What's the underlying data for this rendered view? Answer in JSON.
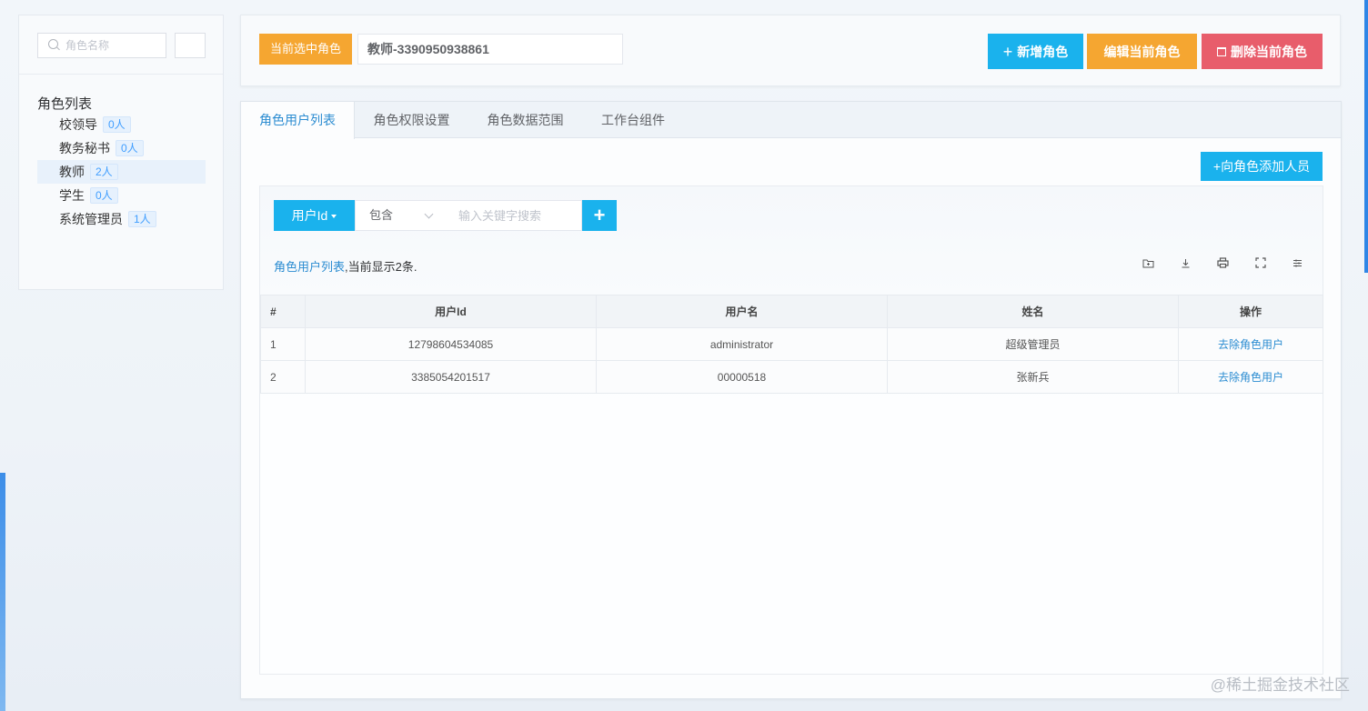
{
  "sidebar": {
    "search_placeholder": "角色名称",
    "tree_root": "角色列表",
    "roles": [
      {
        "name": "校领导",
        "count": "0人"
      },
      {
        "name": "教务秘书",
        "count": "0人"
      },
      {
        "name": "教师",
        "count": "2人"
      },
      {
        "name": "学生",
        "count": "0人"
      },
      {
        "name": "系统管理员",
        "count": "1人"
      }
    ]
  },
  "topbar": {
    "current_label": "当前选中角色",
    "current_value": "教师-3390950938861",
    "add_role": "新增角色",
    "edit_role": "编辑当前角色",
    "delete_role": "删除当前角色"
  },
  "tabs": [
    "角色用户列表",
    "角色权限设置",
    "角色数据范围",
    "工作台组件"
  ],
  "add_member": "+向角色添加人员",
  "filter": {
    "field": "用户Id",
    "operator": "包含",
    "placeholder": "输入关键字搜索",
    "add": "+"
  },
  "caption": {
    "highlight": "角色用户列表",
    "rest": ",当前显示2条."
  },
  "table": {
    "headers": [
      "#",
      "用户Id",
      "用户名",
      "姓名",
      "操作"
    ],
    "rows": [
      {
        "no": "1",
        "user_id": "12798604534085",
        "username": "administrator",
        "name": "超级管理员",
        "action": "去除角色用户"
      },
      {
        "no": "2",
        "user_id": "3385054201517",
        "username": "00000518",
        "name": "张新兵",
        "action": "去除角色用户"
      }
    ]
  },
  "watermark": "@稀土掘金技术社区",
  "colors": {
    "accent": "#1ab2ed",
    "warning": "#f5a631",
    "danger": "#e85d6b",
    "link": "#2b8cd1"
  }
}
